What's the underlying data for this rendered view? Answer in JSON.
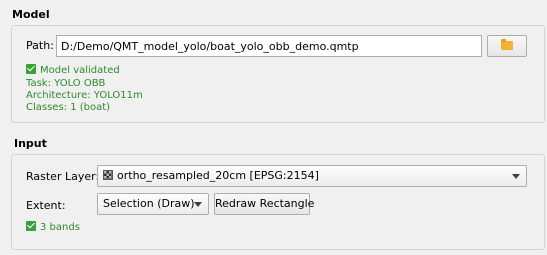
{
  "model": {
    "section_title": "Model",
    "path_label": "Path:",
    "path_value": "D:/Demo/QMT_model_yolo/boat_yolo_obb_demo.qmtp",
    "browse_icon": "folder-icon",
    "validation": {
      "status": "Model validated",
      "task": "Task: YOLO OBB",
      "architecture": "Architecture: YOLO11m",
      "classes": "Classes: 1 (boat)"
    }
  },
  "input": {
    "section_title": "Input",
    "raster_label": "Raster Layer:",
    "raster_value": "ortho_resampled_20cm [EPSG:2154]",
    "raster_icon": "raster-layer-icon",
    "extent_label": "Extent:",
    "extent_value": "Selection (Draw)",
    "redraw_button": "Redraw Rectangle",
    "bands_status": "3 bands"
  },
  "colors": {
    "status_green": "#2e8b2e",
    "check_green": "#3aa13a",
    "folder_yellow": "#f0b432"
  }
}
